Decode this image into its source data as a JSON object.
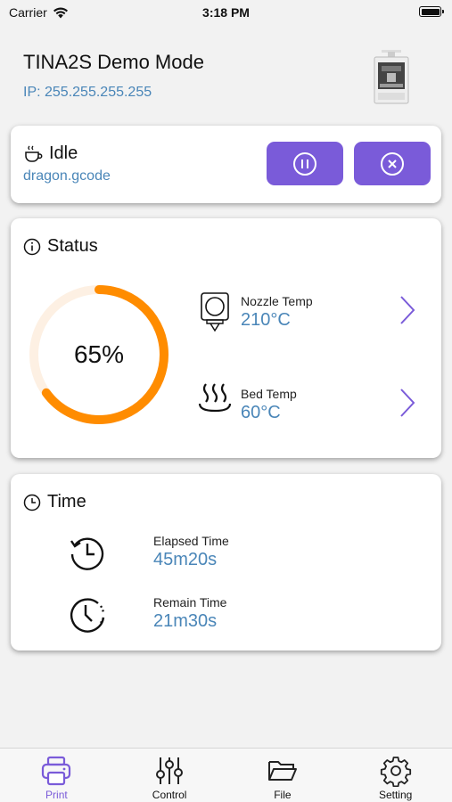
{
  "status_bar": {
    "carrier": "Carrier",
    "time": "3:18 PM",
    "battery_level": 1.0
  },
  "header": {
    "title": "TINA2S Demo Mode",
    "ip": "IP: 255.255.255.255"
  },
  "job": {
    "state": "Idle",
    "state_icon": "coffee-cup-icon",
    "file": "dragon.gcode",
    "pause_icon": "pause-icon",
    "cancel_icon": "cancel-icon"
  },
  "status": {
    "title": "Status",
    "title_icon": "info-icon",
    "progress_label": "65%",
    "progress_fraction": 0.65,
    "nozzle": {
      "label": "Nozzle Temp",
      "value": "210°C",
      "icon": "nozzle-icon"
    },
    "bed": {
      "label": "Bed Temp",
      "value": "60°C",
      "icon": "heat-bed-icon"
    }
  },
  "time": {
    "title": "Time",
    "title_icon": "clock-icon",
    "elapsed": {
      "label": "Elapsed Time",
      "value": "45m20s",
      "icon": "history-clock-icon"
    },
    "remain": {
      "label": "Remain Time",
      "value": "21m30s",
      "icon": "timer-clock-icon"
    }
  },
  "tabs": [
    {
      "label": "Print",
      "icon": "printer-icon",
      "active": true
    },
    {
      "label": "Control",
      "icon": "sliders-icon",
      "active": false
    },
    {
      "label": "File",
      "icon": "folder-icon",
      "active": false
    },
    {
      "label": "Setting",
      "icon": "gear-icon",
      "active": false
    }
  ],
  "colors": {
    "accent": "#7a5bd9",
    "link_blue": "#4a86b8",
    "progress_orange": "#ff8c00",
    "progress_track": "#fdf0e3",
    "background": "#f2f2f2"
  }
}
